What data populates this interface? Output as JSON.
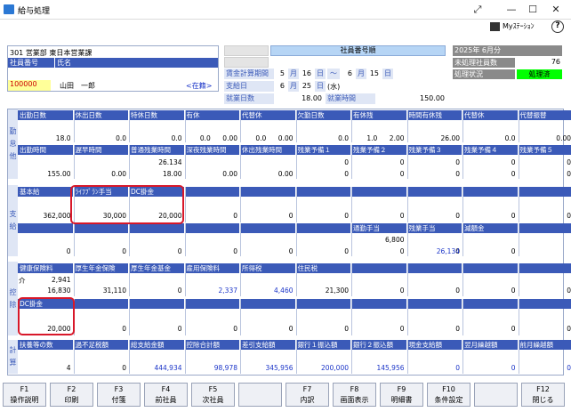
{
  "window": {
    "title": "給与処理",
    "mystation": "Myｽﾃｰｼｮﾝ",
    "help": "?"
  },
  "employee": {
    "dept": "301 営業部 東日本営業課",
    "no_label": "社員番号",
    "name_label": "氏名",
    "no_value": "100000",
    "name_value": "山田　一郎",
    "status": "<在籍>"
  },
  "order": {
    "label": "社員番号順"
  },
  "period": {
    "label": "賃金計算期間",
    "from_m": "5",
    "m1": "月",
    "from_d": "16",
    "d1": "日",
    "sep": "〜",
    "to_m": "6",
    "m2": "月",
    "to_d": "15",
    "d2": "日",
    "pay_label": "支給日",
    "pay_m": "6",
    "m3": "月",
    "pay_d": "25",
    "d3": "日",
    "dow": "(水)",
    "days_label": "就業日数",
    "days_value": "18.00",
    "hours_label": "就業時間",
    "hours_value": "150.00"
  },
  "right": {
    "year": "2025年 6月分",
    "unproc_label": "未処理社員数",
    "unproc_value": "76",
    "status_label": "処理状況",
    "status_value": "処理済"
  },
  "sections": {
    "kintai": "勤怠他",
    "shikyu": "支給",
    "kojo": "控除",
    "keisan": "計算"
  },
  "kintai": {
    "row1_headers": [
      "出勤日数",
      "休出日数",
      "特休日数",
      "有休",
      "代替休",
      "欠勤日数",
      "有休残",
      "時間有休残",
      "代替休",
      "代替振替"
    ],
    "row1_values": [
      [
        "18.0"
      ],
      [
        "0.0"
      ],
      [
        "0.0"
      ],
      [
        "0.0",
        "0.00"
      ],
      [
        "0.0",
        "0.00"
      ],
      [
        "0.0"
      ],
      [
        "1.0",
        "2.00"
      ],
      [
        "26.00"
      ],
      [
        "0.0"
      ],
      [
        "0.00"
      ]
    ],
    "row2_headers": [
      "出勤時間",
      "遅早時間",
      "普通残業時間",
      "深夜残業時間",
      "休出残業時間",
      "残業予備１",
      "残業予備２",
      "残業予備３",
      "残業予備４",
      "残業予備５"
    ],
    "row2_values": [
      [
        "155.00"
      ],
      [
        "0.00"
      ],
      [
        "26.134",
        "18.00"
      ],
      [
        "0.00"
      ],
      [
        "0.00"
      ],
      [
        "0",
        "0"
      ],
      [
        "0",
        "0"
      ],
      [
        "0",
        "0"
      ],
      [
        "0",
        "0"
      ],
      [
        "0",
        "0"
      ]
    ]
  },
  "shikyu": {
    "row1_headers": [
      "基本給",
      "ﾗｲﾌﾌﾟﾗﾝ手当",
      "DC掛金",
      "",
      "",
      "",
      "",
      "",
      "",
      ""
    ],
    "row1_values": [
      "362,000",
      "30,000",
      "20,000",
      "0",
      "0",
      "0",
      "0",
      "0",
      "0",
      "0"
    ],
    "row2_headers": [
      "",
      "",
      "",
      "",
      "",
      "",
      "通勤手当",
      "残業手当",
      "減額金",
      ""
    ],
    "row2_values": [
      "0",
      "0",
      "0",
      "0",
      "0",
      "0",
      "0",
      "0",
      "0",
      ""
    ],
    "row2_extra": [
      "6,800",
      "26,134"
    ]
  },
  "kojo": {
    "row1_headers": [
      "健康保険料",
      "厚生年金保険",
      "厚生年金基金",
      "雇用保険料",
      "所得税",
      "住民税",
      "",
      "",
      "",
      ""
    ],
    "kaigo_label": "介",
    "kaigo_value": "2,941",
    "row1_values": [
      "16,830",
      "31,110",
      "0",
      "2,337",
      "4,460",
      "21,300",
      "0",
      "0",
      "0",
      "0"
    ],
    "row2_headers": [
      "DC掛金",
      "",
      "",
      "",
      "",
      "",
      "",
      "",
      "",
      ""
    ],
    "row2_values": [
      "20,000",
      "0",
      "0",
      "0",
      "0",
      "0",
      "0",
      "0",
      "0",
      "0"
    ]
  },
  "keisan": {
    "headers": [
      "扶養等の数",
      "過不足税額",
      "総支給金額",
      "控除合計額",
      "差引支給額",
      "銀行１振込額",
      "銀行２振込額",
      "現金支給額",
      "翌月繰越額",
      "前月繰越額"
    ],
    "values": [
      "4",
      "0",
      "444,934",
      "98,978",
      "345,956",
      "200,000",
      "145,956",
      "0",
      "0",
      "0"
    ]
  },
  "fkeys": [
    [
      "F1",
      "操作説明"
    ],
    [
      "F2",
      "印刷"
    ],
    [
      "F3",
      "付箋"
    ],
    [
      "F4",
      "前社員"
    ],
    [
      "F5",
      "次社員"
    ],
    [
      "",
      ""
    ],
    [
      "F7",
      "内訳"
    ],
    [
      "F8",
      "画面表示"
    ],
    [
      "F9",
      "明細書"
    ],
    [
      "F10",
      "条件設定"
    ],
    [
      "",
      ""
    ],
    [
      "F12",
      "閉じる"
    ]
  ]
}
